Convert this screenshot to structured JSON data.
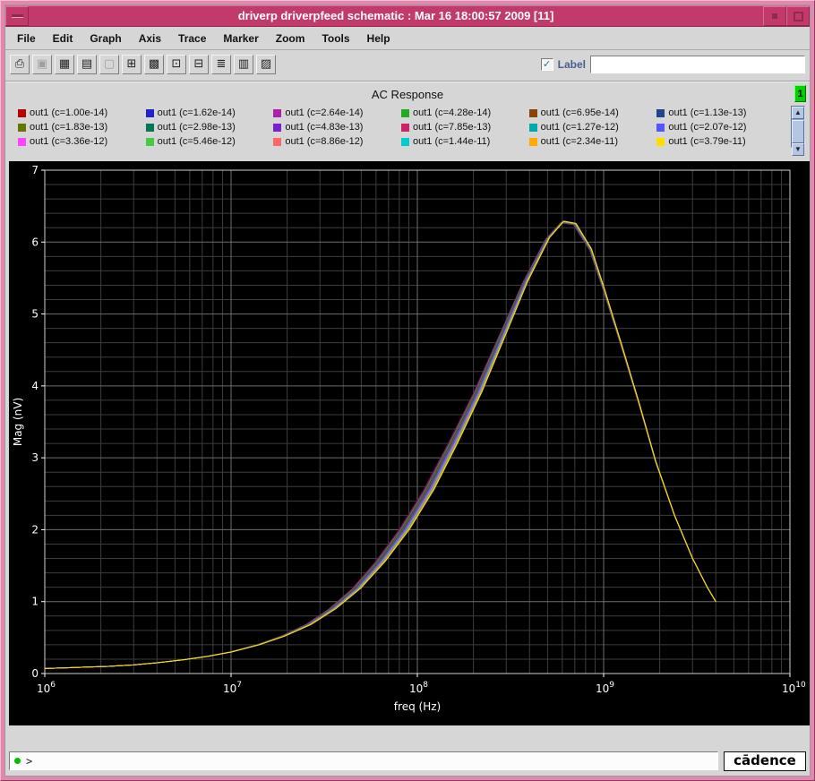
{
  "window": {
    "title": "driverp driverpfeed schematic : Mar 16 18:00:57 2009 [11]",
    "badge": "1"
  },
  "menu": {
    "items": [
      "File",
      "Edit",
      "Graph",
      "Axis",
      "Trace",
      "Marker",
      "Zoom",
      "Tools",
      "Help"
    ]
  },
  "toolbar": {
    "label_checkbox": "Label",
    "check_glyph": "✓",
    "label_value": "",
    "icons": [
      {
        "name": "print-icon",
        "glyph": "⎙",
        "disabled": false
      },
      {
        "name": "snapshot-icon",
        "glyph": "▣",
        "disabled": true
      },
      {
        "name": "grid-display-icon",
        "glyph": "▦",
        "disabled": false
      },
      {
        "name": "strip-display-icon",
        "glyph": "▤",
        "disabled": false
      },
      {
        "name": "blank-display-icon",
        "glyph": "▢",
        "disabled": true
      },
      {
        "name": "new-subwindow-icon",
        "glyph": "⊞",
        "disabled": false
      },
      {
        "name": "overlay-icon",
        "glyph": "▩",
        "disabled": false
      },
      {
        "name": "copy-window-icon",
        "glyph": "⊡",
        "disabled": false
      },
      {
        "name": "delete-subwindow-icon",
        "glyph": "⊟",
        "disabled": false
      },
      {
        "name": "list-icon",
        "glyph": "≣",
        "disabled": false
      },
      {
        "name": "table-icon",
        "glyph": "▥",
        "disabled": false
      },
      {
        "name": "hardcopy-options-icon",
        "glyph": "▨",
        "disabled": false
      }
    ]
  },
  "scrollbar": {
    "up_glyph": "▲",
    "down_glyph": "▼"
  },
  "chart_data": {
    "type": "line",
    "title": "AC Response",
    "xlabel": "freq (Hz)",
    "ylabel": "Mag (nV)",
    "xscale": "log",
    "xlim": [
      1000000,
      10000000000
    ],
    "ylim": [
      0,
      7
    ],
    "x_tick_exponents": [
      6,
      7,
      8,
      9,
      10
    ],
    "y_ticks": [
      0,
      1,
      2,
      3,
      4,
      5,
      6,
      7
    ],
    "grid": true,
    "legend_position": "top",
    "overlap_note": "all 18 series nearly coincide; slight fan-out on rising edge near 1e8 Hz",
    "series": [
      {
        "label": "out1 (c=1.00e-14)",
        "color": "#bb0000"
      },
      {
        "label": "out1 (c=1.62e-14)",
        "color": "#2222cc"
      },
      {
        "label": "out1 (c=2.64e-14)",
        "color": "#aa22aa"
      },
      {
        "label": "out1 (c=4.28e-14)",
        "color": "#22aa22"
      },
      {
        "label": "out1 (c=6.95e-14)",
        "color": "#884400"
      },
      {
        "label": "out1 (c=1.13e-13)",
        "color": "#224488"
      },
      {
        "label": "out1 (c=1.83e-13)",
        "color": "#667700"
      },
      {
        "label": "out1 (c=2.98e-13)",
        "color": "#007755"
      },
      {
        "label": "out1 (c=4.83e-13)",
        "color": "#7722cc"
      },
      {
        "label": "out1 (c=7.85e-13)",
        "color": "#cc2266"
      },
      {
        "label": "out1 (c=1.27e-12)",
        "color": "#00aaaa"
      },
      {
        "label": "out1 (c=2.07e-12)",
        "color": "#5555ff"
      },
      {
        "label": "out1 (c=3.36e-12)",
        "color": "#ff44ff"
      },
      {
        "label": "out1 (c=5.46e-12)",
        "color": "#44cc44"
      },
      {
        "label": "out1 (c=8.86e-12)",
        "color": "#ff6666"
      },
      {
        "label": "out1 (c=1.44e-11)",
        "color": "#00cccc"
      },
      {
        "label": "out1 (c=2.34e-11)",
        "color": "#ffaa00"
      },
      {
        "label": "out1 (c=3.79e-11)",
        "color": "#ffdd00"
      }
    ],
    "base_curve": {
      "freq": [
        1000000.0,
        1300000.0,
        1700000.0,
        2200000.0,
        3000000.0,
        4000000.0,
        5500000.0,
        7500000.0,
        10000000.0,
        14000000.0,
        19000000.0,
        26000000.0,
        35000000.0,
        47000000.0,
        63000000.0,
        85000000.0,
        115000000.0,
        155000000.0,
        210000000.0,
        280000000.0,
        380000000.0,
        500000000.0,
        600000000.0,
        700000000.0,
        850000000.0,
        1000000000.0,
        1250000000.0,
        1550000000.0,
        1900000000.0,
        2400000000.0,
        3000000000.0,
        3600000000.0,
        4000000000.0
      ],
      "mag": [
        0.07,
        0.08,
        0.09,
        0.1,
        0.12,
        0.15,
        0.19,
        0.24,
        0.3,
        0.4,
        0.52,
        0.68,
        0.9,
        1.18,
        1.55,
        2.0,
        2.55,
        3.2,
        3.9,
        4.65,
        5.45,
        6.05,
        6.28,
        6.25,
        5.9,
        5.35,
        4.55,
        3.75,
        2.95,
        2.2,
        1.6,
        1.2,
        1.0
      ]
    }
  },
  "statusbar": {
    "prompt": ">",
    "logo_text": "cādence"
  }
}
